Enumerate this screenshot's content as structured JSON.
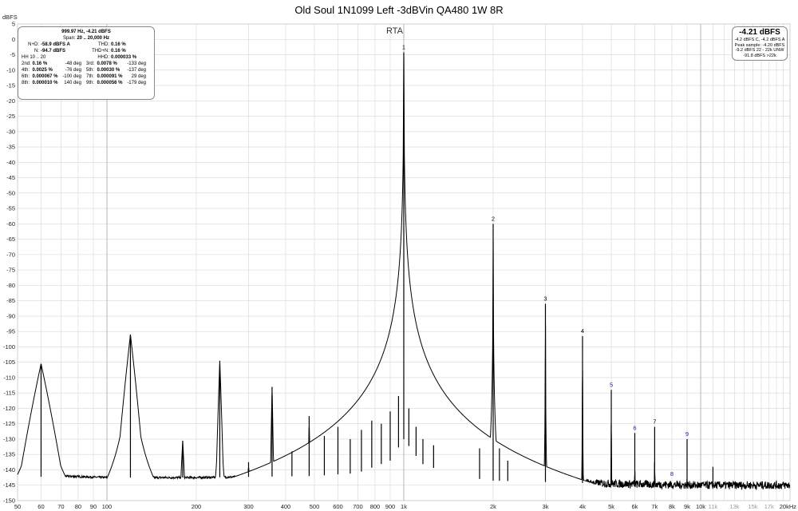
{
  "chart_data": {
    "type": "line",
    "title": "Old Soul 1N1099 Left -3dBVin QA480 1W 8R",
    "subtitle": "RTA",
    "ylabel": "dBFS",
    "xlabel": "",
    "x_scale": "log",
    "xlim": [
      50,
      20000
    ],
    "ylim": [
      -150,
      5
    ],
    "grid": true,
    "y_ticks": [
      "5",
      "0",
      "-5",
      "-10",
      "-15",
      "-20",
      "-25",
      "-30",
      "-35",
      "-40",
      "-45",
      "-50",
      "-55",
      "-60",
      "-65",
      "-70",
      "-75",
      "-80",
      "-85",
      "-90",
      "-95",
      "-100",
      "-105",
      "-110",
      "-115",
      "-120",
      "-125",
      "-130",
      "-135",
      "-140",
      "-145",
      "-150"
    ],
    "x_ticks_major": [
      {
        "f": 50,
        "label": "50"
      },
      {
        "f": 60,
        "label": "60"
      },
      {
        "f": 70,
        "label": "70"
      },
      {
        "f": 80,
        "label": "80"
      },
      {
        "f": 90,
        "label": "90"
      },
      {
        "f": 100,
        "label": "100"
      },
      {
        "f": 200,
        "label": "200"
      },
      {
        "f": 300,
        "label": "300"
      },
      {
        "f": 400,
        "label": "400"
      },
      {
        "f": 500,
        "label": "500"
      },
      {
        "f": 600,
        "label": "600"
      },
      {
        "f": 700,
        "label": "700"
      },
      {
        "f": 800,
        "label": "800"
      },
      {
        "f": 900,
        "label": "900"
      },
      {
        "f": 1000,
        "label": "1k"
      },
      {
        "f": 2000,
        "label": "2k"
      },
      {
        "f": 3000,
        "label": "3k"
      },
      {
        "f": 4000,
        "label": "4k"
      },
      {
        "f": 5000,
        "label": "5k"
      },
      {
        "f": 6000,
        "label": "6k"
      },
      {
        "f": 7000,
        "label": "7k"
      },
      {
        "f": 8000,
        "label": "8k"
      },
      {
        "f": 9000,
        "label": "9k"
      },
      {
        "f": 10000,
        "label": "10k"
      },
      {
        "f": 20000,
        "label": "20kHz"
      }
    ],
    "x_ticks_minor": [
      {
        "f": 11000,
        "label": "11k"
      },
      {
        "f": 13000,
        "label": "13k"
      },
      {
        "f": 15000,
        "label": "15k"
      },
      {
        "f": 17000,
        "label": "17k"
      }
    ],
    "noise_floor": [
      {
        "f": 50,
        "db": -142.5
      },
      {
        "f": 70,
        "db": -142
      },
      {
        "f": 100,
        "db": -142.5
      },
      {
        "f": 200,
        "db": -142.5
      },
      {
        "f": 500,
        "db": -142
      },
      {
        "f": 700,
        "db": -141
      },
      {
        "f": 900,
        "db": -137
      },
      {
        "f": 1000,
        "db": -130
      },
      {
        "f": 1150,
        "db": -138
      },
      {
        "f": 1500,
        "db": -142
      },
      {
        "f": 2000,
        "db": -143.5
      },
      {
        "f": 5000,
        "db": -144.5
      },
      {
        "f": 10000,
        "db": -145
      },
      {
        "f": 20000,
        "db": -145
      }
    ],
    "peaks": [
      {
        "f": 60,
        "db": -105.5,
        "wide": 0.085
      },
      {
        "f": 120,
        "db": -96,
        "wide": 0.045
      },
      {
        "f": 180,
        "db": -130.5,
        "wide": 0.02
      },
      {
        "f": 240,
        "db": -104.5,
        "wide": 0.014
      },
      {
        "f": 300,
        "db": -137.5,
        "wide": 0.01
      },
      {
        "f": 360,
        "db": -113,
        "wide": 0.008
      },
      {
        "f": 420,
        "db": -134,
        "wide": 0.006
      },
      {
        "f": 480,
        "db": -122.5,
        "wide": 0.005
      },
      {
        "f": 540,
        "db": -129,
        "wide": 0.005
      },
      {
        "f": 600,
        "db": -126,
        "wide": 0.004
      },
      {
        "f": 660,
        "db": -130,
        "wide": 0.004
      },
      {
        "f": 720,
        "db": -127,
        "wide": 0.004
      },
      {
        "f": 780,
        "db": -124,
        "wide": 0.004
      },
      {
        "f": 840,
        "db": -125,
        "wide": 0.004
      },
      {
        "f": 900,
        "db": -121,
        "wide": 0.004
      },
      {
        "f": 960,
        "db": -116,
        "wide": 0.003
      },
      {
        "f": 999.97,
        "db": -4.21,
        "wide": 0.0025
      },
      {
        "f": 1040,
        "db": -120,
        "wide": 0.003
      },
      {
        "f": 1100,
        "db": -126,
        "wide": 0.003
      },
      {
        "f": 1160,
        "db": -130,
        "wide": 0.003
      },
      {
        "f": 1260,
        "db": -132,
        "wide": 0.002
      },
      {
        "f": 1800,
        "db": -133,
        "wide": 0.002
      },
      {
        "f": 2000,
        "db": -60,
        "wide": 0.0015
      },
      {
        "f": 2100,
        "db": -133,
        "wide": 0.002
      },
      {
        "f": 2240,
        "db": -137,
        "wide": 0.002
      },
      {
        "f": 3000,
        "db": -86,
        "wide": 0.0015
      },
      {
        "f": 4000,
        "db": -96.5,
        "wide": 0.0015
      },
      {
        "f": 5000,
        "db": -114,
        "wide": 0.0015
      },
      {
        "f": 6000,
        "db": -128,
        "wide": 0.0015
      },
      {
        "f": 7000,
        "db": -126,
        "wide": 0.0015
      },
      {
        "f": 9000,
        "db": -130,
        "wide": 0.0015
      },
      {
        "f": 11000,
        "db": -139,
        "wide": 0.0015
      }
    ],
    "harmonic_labels": [
      {
        "n": "1",
        "f": 999.97,
        "db": -4.21,
        "color": "black"
      },
      {
        "n": "2",
        "f": 2000,
        "db": -60,
        "color": "black"
      },
      {
        "n": "3",
        "f": 3000,
        "db": -86,
        "color": "black"
      },
      {
        "n": "4",
        "f": 4000,
        "db": -96.5,
        "color": "black"
      },
      {
        "n": "5",
        "f": 5000,
        "db": -114,
        "color": "blue"
      },
      {
        "n": "6",
        "f": 6000,
        "db": -128,
        "color": "blue"
      },
      {
        "n": "7",
        "f": 7000,
        "db": -126,
        "color": "black"
      },
      {
        "n": "8",
        "f": 8000,
        "db": -143,
        "color": "blue"
      },
      {
        "n": "9",
        "f": 9000,
        "db": -130,
        "color": "blue"
      }
    ],
    "series_color": "#000000",
    "grid_color": "#d6d6d6",
    "minor_grid_color": "#ededed"
  },
  "stats": {
    "header1": "999.97 Hz, -4.21 dBFS",
    "header2_label": "Span:",
    "header2_value": "20 .. 20,000 Hz",
    "rows": [
      [
        {
          "l": "N+D:",
          "v": "-58.9 dBFS A"
        },
        {
          "l": "THD:",
          "v": "0.16 %"
        }
      ],
      [
        {
          "l": "N:",
          "v": "-94.7 dBFS"
        },
        {
          "l": "THD+N:",
          "v": "0.16 %"
        }
      ],
      [
        {
          "l": "HH 10 .. 20",
          "v": ""
        },
        {
          "l": "HHD:",
          "v": "0.000033 %"
        }
      ]
    ],
    "harmonics": [
      [
        {
          "l": "2nd:",
          "v": "0.16 %",
          "d": "-48 deg"
        },
        {
          "l": "3rd:",
          "v": "0.0078 %",
          "d": "-133 deg"
        }
      ],
      [
        {
          "l": "4th:",
          "v": "0.0025 %",
          "d": "-76 deg"
        },
        {
          "l": "5th:",
          "v": "0.00030 %",
          "d": "-137 deg"
        }
      ],
      [
        {
          "l": "6th:",
          "v": "0.000067 %",
          "d": "-100 deg"
        },
        {
          "l": "7th:",
          "v": "0.000091 %",
          "d": "29 deg"
        }
      ],
      [
        {
          "l": "8th:",
          "v": "0.000010 %",
          "d": "140 deg"
        },
        {
          "l": "9th:",
          "v": "0.000056 %",
          "d": "-179 deg"
        }
      ]
    ]
  },
  "level_box": {
    "big": "-4.21 dBFS",
    "line1": "-4.2 dBFS C, -4.2 dBFS A",
    "line2": "Peak sample: -4.20 dBFS",
    "line3": "-9.2 dBFS 22 - 22k UNW",
    "line4": "-91.8 dBFS >22k"
  }
}
